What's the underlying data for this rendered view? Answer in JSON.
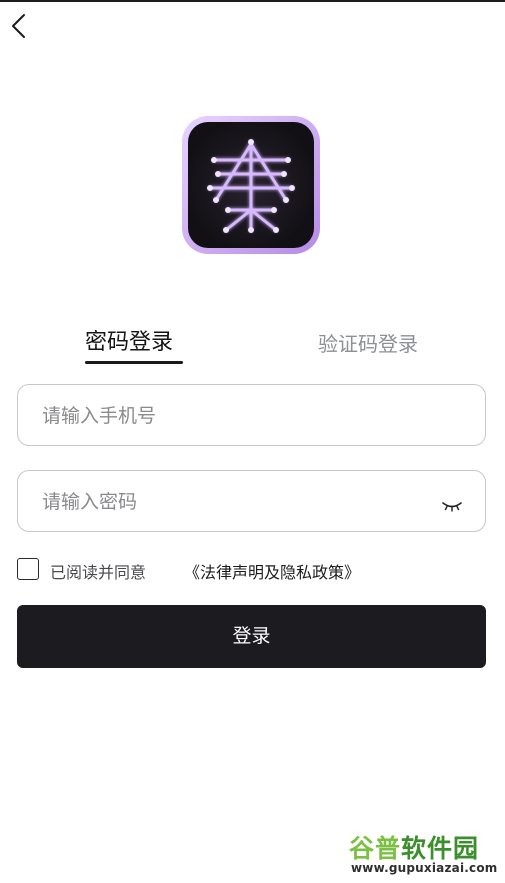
{
  "header": {
    "back_icon": "chevron-left-icon"
  },
  "logo": {
    "icon": "qin-character-app-logo",
    "text": "秦"
  },
  "tabs": [
    {
      "label": "密码登录",
      "active": true
    },
    {
      "label": "验证码登录",
      "active": false
    }
  ],
  "form": {
    "phone_placeholder": "请输入手机号",
    "password_placeholder": "请输入密码",
    "password_toggle_icon": "eye-closed-icon",
    "agree_text": "已阅读并同意",
    "agree_link": "《法律声明及隐私政策》",
    "checked": false
  },
  "login_button": {
    "label": "登录"
  },
  "watermark": {
    "brand_part1": "谷普",
    "brand_part2": "软件园",
    "url": "www.gupuxiazai.com"
  },
  "colors": {
    "button_bg": "#1c1b20",
    "logo_glow": "#c9a6ff",
    "inactive_tab": "#8d8f94",
    "border": "#c8c8cc"
  }
}
